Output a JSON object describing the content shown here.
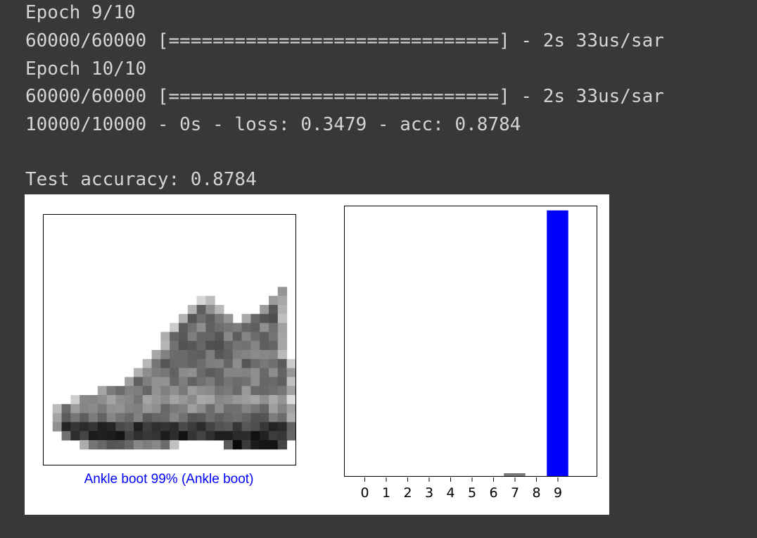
{
  "console": {
    "lines": [
      "Epoch 9/10",
      "60000/60000 [==============================] - 2s 33us/sar",
      "Epoch 10/10",
      "60000/60000 [==============================] - 2s 33us/sar",
      "10000/10000 - 0s - loss: 0.3479 - acc: 0.8784",
      "",
      "Test accuracy: 0.8784"
    ]
  },
  "figure": {
    "caption": "Ankle boot 99% (Ankle boot)",
    "caption_color": "#0000ff"
  },
  "chart_data": {
    "type": "bar",
    "categories": [
      "0",
      "1",
      "2",
      "3",
      "4",
      "5",
      "6",
      "7",
      "8",
      "9"
    ],
    "values": [
      0.0,
      0.0,
      0.0,
      0.0,
      0.0,
      0.0,
      0.0,
      0.01,
      0.0,
      0.99
    ],
    "ylim": [
      0,
      1
    ],
    "colors": {
      "predicted": "#0000ff",
      "other": "#777777"
    },
    "title": "",
    "xlabel": "",
    "ylabel": ""
  }
}
